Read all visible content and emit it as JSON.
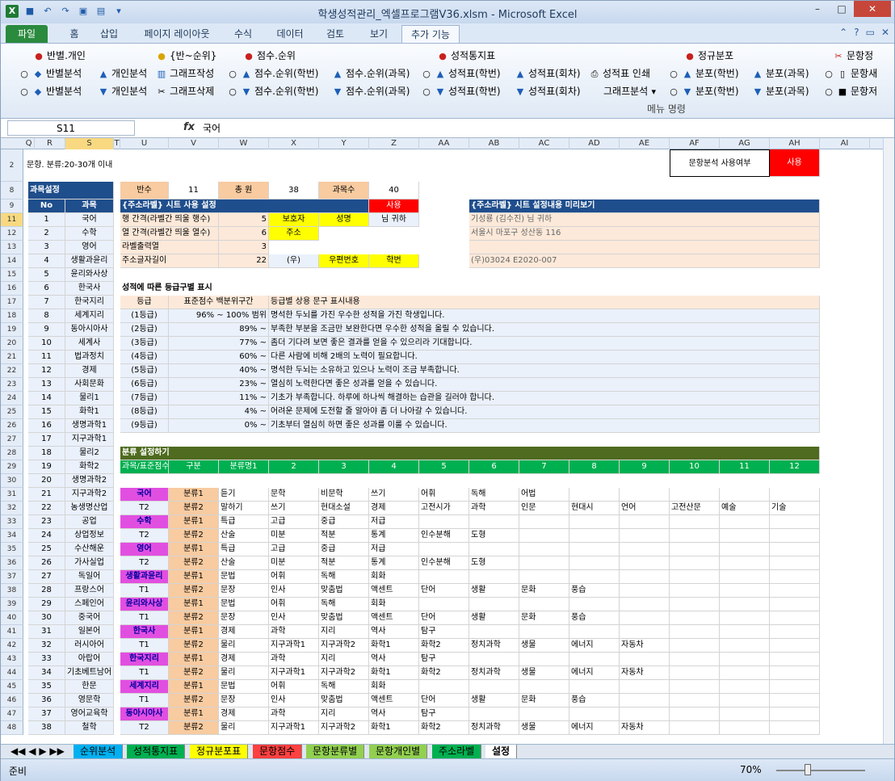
{
  "window": {
    "title": "학생성적관리_엑셀프로그램V36.xlsm  -  Microsoft Excel"
  },
  "tabs": [
    "파일",
    "홈",
    "삽입",
    "페이지 레이아웃",
    "수식",
    "데이터",
    "검토",
    "보기",
    "추가 기능"
  ],
  "ribbon": {
    "row1": [
      "반별.개인",
      "{반~순위}",
      "점수.순위",
      "성적통지표",
      "정규분포",
      "문항정"
    ],
    "row2": [
      "반별분석",
      "개인분석",
      "그래프작성",
      "점수.순위(학번)",
      "점수.순위(과목)",
      "성적표(학번)",
      "성적표(회차)",
      "성적표 인쇄",
      "분포(학번)",
      "분포(과목)",
      "문항새"
    ],
    "row3": [
      "반별분석",
      "개인분석",
      "그래프삭제",
      "점수.순위(학번)",
      "점수.순위(과목)",
      "성적표(학번)",
      "성적표(회차)",
      "그래프분석",
      "분포(학번)",
      "분포(과목)",
      "문항저"
    ],
    "group": "메뉴 명령"
  },
  "formula": {
    "namebox": "S11",
    "fx": "fx",
    "value": "국어"
  },
  "columns": [
    "Q",
    "R",
    "S",
    "T",
    "U",
    "V",
    "W",
    "X",
    "Y",
    "Z",
    "AA",
    "AB",
    "AC",
    "AD",
    "AE",
    "AF",
    "AG",
    "AH",
    "AI"
  ],
  "rows": [
    "2",
    "8",
    "9",
    "11",
    "12",
    "13",
    "14",
    "15",
    "16",
    "17",
    "18",
    "19",
    "20",
    "21",
    "22",
    "23",
    "24",
    "25",
    "26",
    "27",
    "28",
    "29",
    "30",
    "31",
    "32",
    "33",
    "34",
    "35",
    "36",
    "37",
    "38",
    "39",
    "40",
    "41",
    "42",
    "43",
    "44",
    "45",
    "46",
    "47",
    "48"
  ],
  "sheet": {
    "r2_note": "문항. 분류:20-30개 이내",
    "item_use_label": "문항분석 사용여부",
    "item_use_value": "사용",
    "subject_title": "과목설정",
    "no_label": "No",
    "subject_label": "과목",
    "ban_label": "반수",
    "ban_value": "11",
    "total_label": "총 원",
    "total_value": "38",
    "subjcnt_label": "과목수",
    "subjcnt_value": "40",
    "label_sheet_title": "{주소라벨} 시트 사용 설정",
    "label_use": "사용",
    "preview_title": "{주소라벨} 시트 설정내용 미리보기",
    "label_settings": [
      {
        "name": "행 간격(라벨간 띄울 행수)",
        "value": "5"
      },
      {
        "name": "열 간격(라벨간 띄울 열수)",
        "value": "6"
      },
      {
        "name": "라벨출력열",
        "value": "3"
      },
      {
        "name": "주소글자길이",
        "value": "22"
      }
    ],
    "label_fields": [
      "보호자",
      "성명",
      "님 귀하",
      "주소",
      "(우)",
      "우편번호",
      "학번"
    ],
    "preview_lines": [
      "기성룡 (김수진) 님  귀하",
      "서울시 마포구 성산동 116",
      "",
      "(우)03024          E2020-007"
    ],
    "grade_section_title": "성적에 따른 등급구별 표시",
    "grade_headers": [
      "등급",
      "표준점수 백분위구간",
      "등급별 상용 문구 표시내용"
    ],
    "grades": [
      {
        "g": "(1등급)",
        "p": "96% ~ 100% 범위",
        "t": "명석한 두뇌를 가진 우수한 성적을 가진 학생입니다."
      },
      {
        "g": "(2등급)",
        "p": "89% ~",
        "t": "부족한 부분을 조금만 보완한다면 우수한 성적을 올릴 수 있습니다."
      },
      {
        "g": "(3등급)",
        "p": "77% ~",
        "t": "좀더 기다려 보면 좋은 결과를 얻을 수 있으리라 기대합니다."
      },
      {
        "g": "(4등급)",
        "p": "60% ~",
        "t": "다른 사람에 비해 2배의 노력이 필요합니다."
      },
      {
        "g": "(5등급)",
        "p": "40% ~",
        "t": "명석한 두뇌는 소유하고 있으나 노력이 조금 부족합니다."
      },
      {
        "g": "(6등급)",
        "p": "23% ~",
        "t": "열심히 노력한다면 좋은 성과를 얻을 수 있습니다."
      },
      {
        "g": "(7등급)",
        "p": "11% ~",
        "t": "기초가 부족합니다. 하루에 하나씩 해결하는 습관을 길러야 합니다."
      },
      {
        "g": "(8등급)",
        "p": "4% ~",
        "t": "어려운 문제에 도전할 줄 알아야 좀 더 나아갈 수 있습니다."
      },
      {
        "g": "(9등급)",
        "p": "0% ~",
        "t": "기초부터 열심히 하면 좋은 성과를 이룰 수 있습니다."
      }
    ],
    "class_section_title": "분류 설정하기",
    "class_header": [
      "과목/표준점수",
      "구분",
      "분류명1",
      "2",
      "3",
      "4",
      "5",
      "6",
      "7",
      "8",
      "9",
      "10",
      "11",
      "12"
    ],
    "subjects": [
      "국어",
      "수학",
      "영어",
      "생활과윤리",
      "윤리와사상",
      "한국사",
      "한국지리",
      "세계지리",
      "동아시아사",
      "세계사",
      "법과정치",
      "경제",
      "사회문화",
      "물리1",
      "화학1",
      "생명과학1",
      "지구과학1",
      "물리2",
      "화학2",
      "생명과학2",
      "지구과학2",
      "농생명산업",
      "공업",
      "상업정보",
      "수산해운",
      "가사실업",
      "독일어",
      "프랑스어",
      "스페인어",
      "중국어",
      "일본어",
      "러시아어",
      "아랍어",
      "기초베트남어",
      "한문",
      "영문학",
      "영어교육학",
      "철학"
    ],
    "class_rows": [
      {
        "a": "국어",
        "b": "분류1",
        "v": [
          "듣기",
          "문학",
          "비문학",
          "쓰기",
          "어휘",
          "독해",
          "어법",
          "",
          "",
          "",
          "",
          ""
        ]
      },
      {
        "a": "T2",
        "b": "분류2",
        "v": [
          "말하기",
          "쓰기",
          "현대소설",
          "경제",
          "고전시가",
          "과학",
          "인문",
          "현대시",
          "언어",
          "고전산문",
          "예술",
          "기술"
        ]
      },
      {
        "a": "수학",
        "b": "분류1",
        "v": [
          "특급",
          "고급",
          "중급",
          "저급",
          "",
          "",
          "",
          "",
          "",
          "",
          "",
          ""
        ]
      },
      {
        "a": "T2",
        "b": "분류2",
        "v": [
          "산술",
          "미분",
          "적분",
          "통계",
          "인수분해",
          "도형",
          "",
          "",
          "",
          "",
          "",
          ""
        ]
      },
      {
        "a": "영어",
        "b": "분류1",
        "v": [
          "특급",
          "고급",
          "중급",
          "저급",
          "",
          "",
          "",
          "",
          "",
          "",
          "",
          ""
        ]
      },
      {
        "a": "T2",
        "b": "분류2",
        "v": [
          "산술",
          "미분",
          "적분",
          "통계",
          "인수분해",
          "도형",
          "",
          "",
          "",
          "",
          "",
          ""
        ]
      },
      {
        "a": "생활과윤리",
        "b": "분류1",
        "v": [
          "문법",
          "어휘",
          "독해",
          "회화",
          "",
          "",
          "",
          "",
          "",
          "",
          "",
          ""
        ]
      },
      {
        "a": "T1",
        "b": "분류2",
        "v": [
          "문장",
          "인사",
          "맞춤법",
          "액센트",
          "단어",
          "생활",
          "문화",
          "풍습",
          "",
          "",
          "",
          ""
        ]
      },
      {
        "a": "윤리와사상",
        "b": "분류1",
        "v": [
          "문법",
          "어휘",
          "독해",
          "회화",
          "",
          "",
          "",
          "",
          "",
          "",
          "",
          ""
        ]
      },
      {
        "a": "T1",
        "b": "분류2",
        "v": [
          "문장",
          "인사",
          "맞춤법",
          "액센트",
          "단어",
          "생활",
          "문화",
          "풍습",
          "",
          "",
          "",
          ""
        ]
      },
      {
        "a": "한국사",
        "b": "분류1",
        "v": [
          "경제",
          "과학",
          "지리",
          "역사",
          "탐구",
          "",
          "",
          "",
          "",
          "",
          "",
          ""
        ]
      },
      {
        "a": "T1",
        "b": "분류2",
        "v": [
          "물리",
          "지구과학1",
          "지구과학2",
          "화학1",
          "화학2",
          "정치과학",
          "생물",
          "에너지",
          "자동차",
          "",
          "",
          ""
        ]
      },
      {
        "a": "한국지리",
        "b": "분류1",
        "v": [
          "경제",
          "과학",
          "지리",
          "역사",
          "탐구",
          "",
          "",
          "",
          "",
          "",
          "",
          ""
        ]
      },
      {
        "a": "T1",
        "b": "분류2",
        "v": [
          "물리",
          "지구과학1",
          "지구과학2",
          "화학1",
          "화학2",
          "정치과학",
          "생물",
          "에너지",
          "자동차",
          "",
          "",
          ""
        ]
      },
      {
        "a": "세계지리",
        "b": "분류1",
        "v": [
          "문법",
          "어휘",
          "독해",
          "회화",
          "",
          "",
          "",
          "",
          "",
          "",
          "",
          ""
        ]
      },
      {
        "a": "T1",
        "b": "분류2",
        "v": [
          "문장",
          "인사",
          "맞춤법",
          "액센트",
          "단어",
          "생활",
          "문화",
          "풍습",
          "",
          "",
          "",
          ""
        ]
      },
      {
        "a": "동아시아사",
        "b": "분류1",
        "v": [
          "경제",
          "과학",
          "지리",
          "역사",
          "탐구",
          "",
          "",
          "",
          "",
          "",
          "",
          ""
        ]
      },
      {
        "a": "T2",
        "b": "분류2",
        "v": [
          "물리",
          "지구과학1",
          "지구과학2",
          "화학1",
          "화학2",
          "정치과학",
          "생물",
          "에너지",
          "자동차",
          "",
          "",
          ""
        ]
      }
    ]
  },
  "sheettabs": [
    "순위분석",
    "성적통지표",
    "정규분포표",
    "문항점수",
    "문항분류별",
    "문항개인별",
    "주소라벨",
    "설정"
  ],
  "status": {
    "ready": "준비",
    "zoom": "70%"
  }
}
